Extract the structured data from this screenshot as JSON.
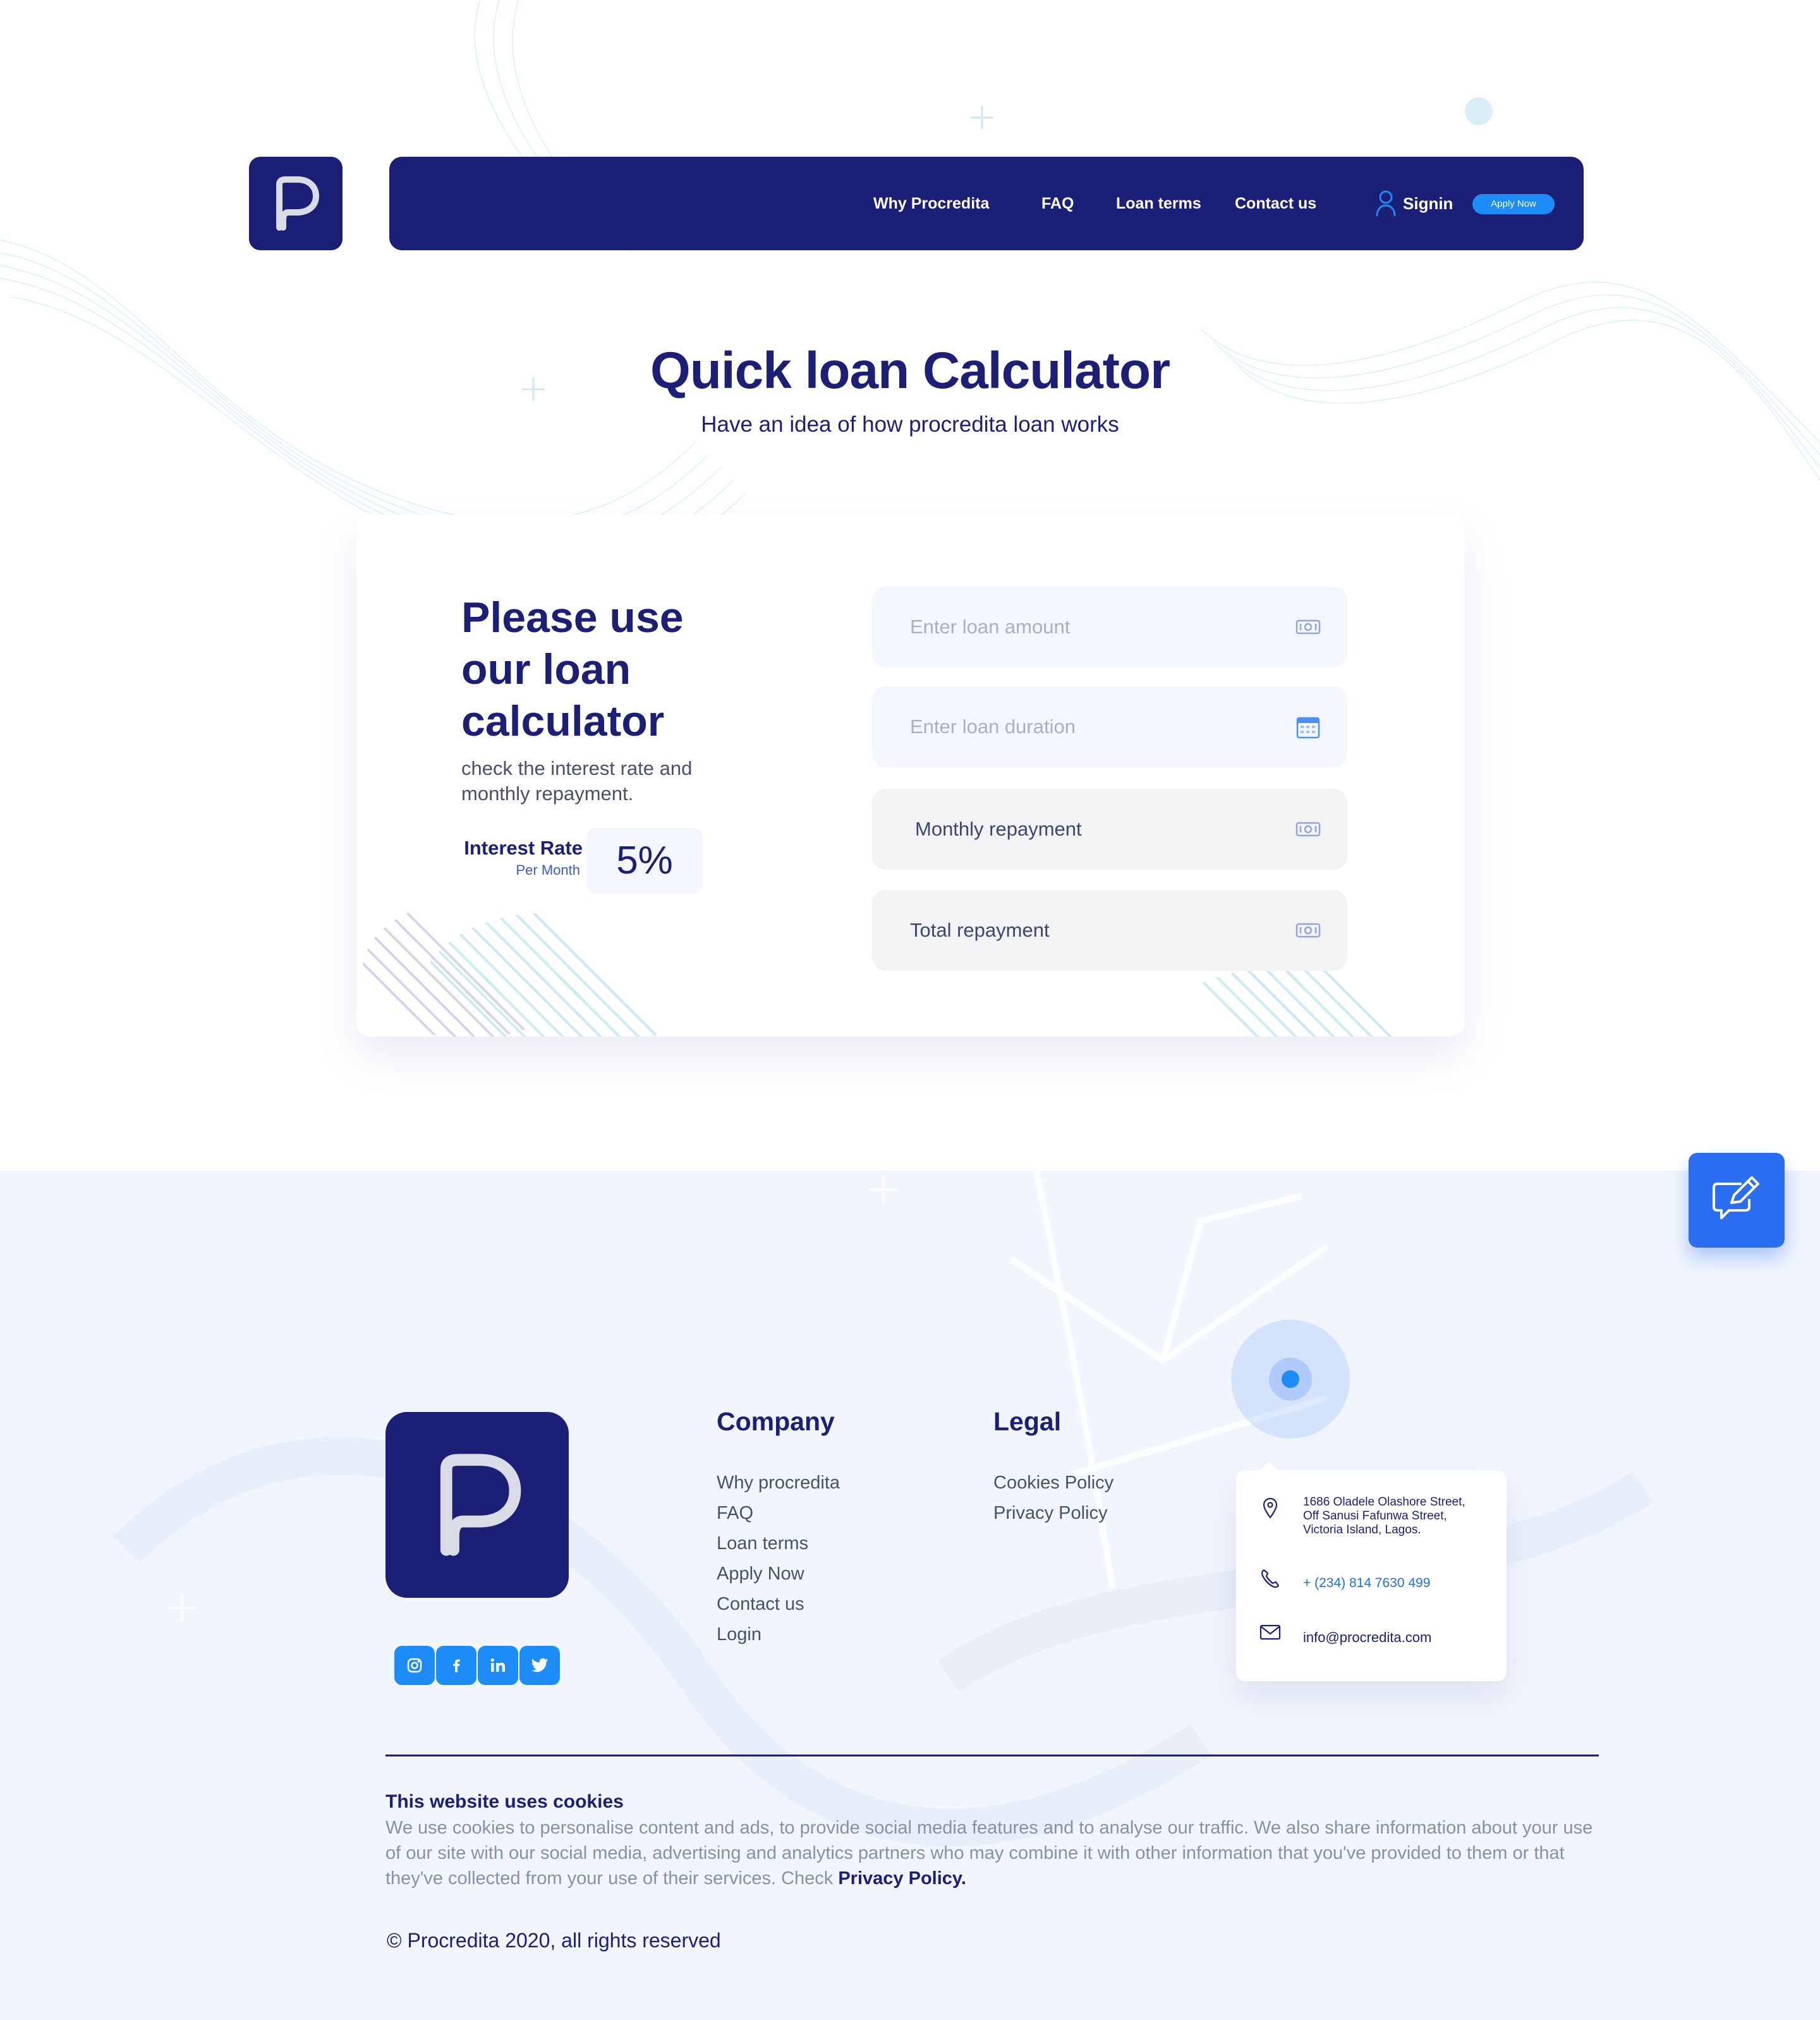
{
  "brand": {
    "name": "Procredita",
    "primary": "#1b1f75",
    "accent": "#1e8cf6",
    "feedback": "#2b6ef2"
  },
  "nav": {
    "links": [
      "Why Procredita",
      "FAQ",
      "Loan terms",
      "Contact us"
    ],
    "signin": "Signin",
    "apply": "Apply Now"
  },
  "hero": {
    "title": "Quick loan Calculator",
    "subtitle": "Have an idea of how procredita loan works"
  },
  "calculator": {
    "heading": "Please use our loan calculator",
    "description": "check the interest rate and monthly repayment.",
    "rate_label": "Interest Rate",
    "rate_period": "Per Month",
    "rate_value": "5%",
    "loan_amount_placeholder": "Enter loan amount",
    "loan_duration_placeholder": "Enter loan duration",
    "monthly_label": "Monthly repayment",
    "total_label": "Total repayment",
    "icons": [
      "money-icon",
      "calendar-icon",
      "money-icon",
      "money-icon"
    ]
  },
  "footer": {
    "company_title": "Company",
    "company_links": [
      "Why procredita",
      "FAQ",
      "Loan terms",
      "Apply Now",
      "Contact us",
      "Login"
    ],
    "legal_title": "Legal",
    "legal_links": [
      "Cookies Policy",
      "Privacy Policy"
    ],
    "social": [
      "instagram-icon",
      "facebook-icon",
      "linkedin-icon",
      "twitter-icon"
    ],
    "address_line1": "1686 Oladele Olashore Street,",
    "address_line2": "Off Sanusi Fafunwa Street,",
    "address_line3": "Victoria Island, Lagos.",
    "phone": "+ (234) 814 7630 499",
    "email": "info@procredita.com",
    "cookie_title": "This website uses cookies",
    "cookie_text": "We use cookies to personalise content and ads, to provide social media features and to analyse our traffic. We also share information about your use of our site with our social media, advertising and analytics partners who may combine it with other information that you've provided to them or that they've collected from your use of their services. Check",
    "cookie_link": "Privacy Policy.",
    "copyright": "© Procredita 2020, all rights reserved"
  }
}
